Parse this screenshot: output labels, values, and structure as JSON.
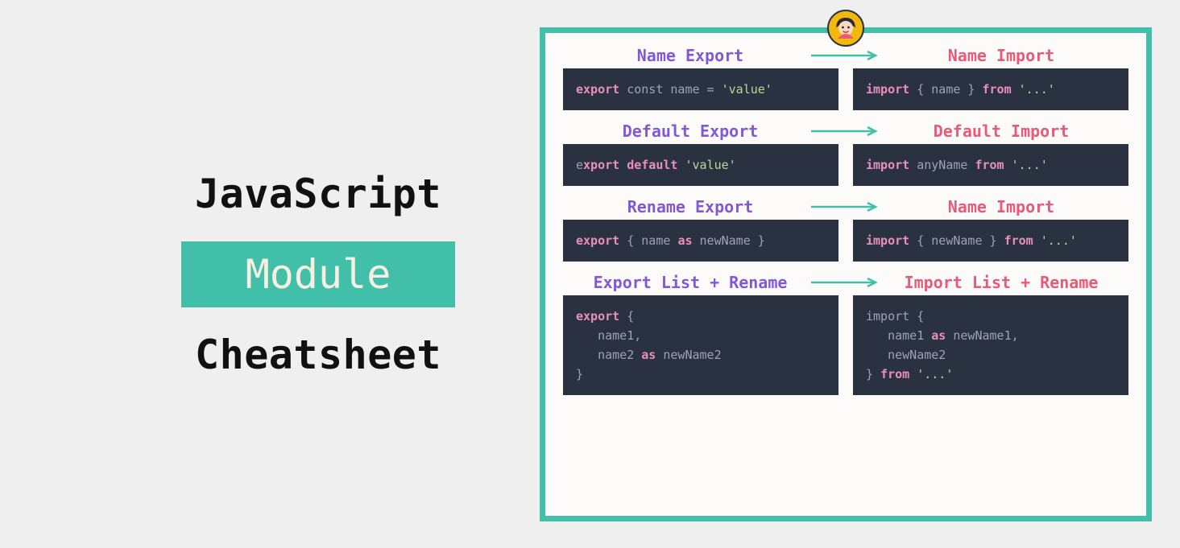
{
  "title": {
    "line1": "JavaScript",
    "pill": "Module",
    "line3": "Cheatsheet"
  },
  "sections": [
    {
      "export_label": "Name Export",
      "import_label": "Name Import",
      "export_code_html": "<span class='kw'>export</span> <span class='dim'>const name =</span> <span class='str'>'value'</span>",
      "import_code_html": "<span class='kw'>import</span> <span class='dim'>{ name }</span> <span class='kw'>from</span> <span class='str'>'...'</span>"
    },
    {
      "export_label": "Default Export",
      "import_label": "Default Import",
      "export_code_html": "<span class='dim'>e</span><span class='kw'>xport default</span> <span class='str'>'value'</span>",
      "import_code_html": "<span class='kw'>import</span> <span class='dim'>anyName</span> <span class='kw'>from</span> <span class='str'>'...'</span>"
    },
    {
      "export_label": "Rename Export",
      "import_label": "Name Import",
      "export_code_html": "<span class='kw'>export</span> <span class='dim'>{ name</span> <span class='kw2'>as</span> <span class='dim'>newName }</span>",
      "import_code_html": "<span class='kw'>import</span> <span class='dim'>{ newName }</span> <span class='kw'>from</span> <span class='str'>'...'</span>"
    },
    {
      "export_label": "Export List + Rename",
      "import_label": "Import List + Rename",
      "export_code_html": "<span class='kw'>export</span> <span class='dim'>{</span>\n   <span class='dim'>name1,</span>\n   <span class='dim'>name2</span> <span class='kw2'>as</span> <span class='dim'>newName2</span>\n<span class='dim'>}</span>",
      "import_code_html": "<span class='dim'>import {</span>\n   <span class='dim'>name1</span> <span class='kw2'>as</span> <span class='dim'>newName1,</span>\n   <span class='dim'>newName2</span>\n<span class='dim'>}</span> <span class='kw'>from</span> <span class='str'>'...'</span>"
    }
  ]
}
